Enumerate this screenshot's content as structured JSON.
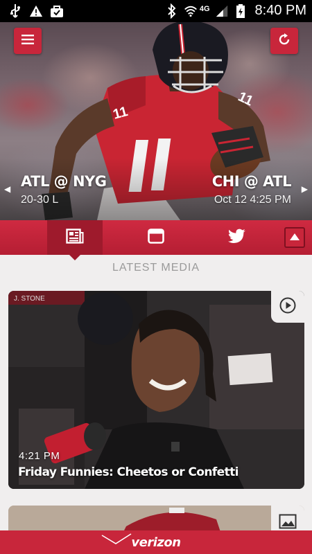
{
  "status_bar": {
    "time": "8:40 PM",
    "network": "4G",
    "left_icons": [
      "usb-icon",
      "warning-icon",
      "bag-icon"
    ],
    "right_icons": [
      "bluetooth-icon",
      "wifi-icon",
      "signal-icon",
      "battery-icon"
    ]
  },
  "hero": {
    "left_game": {
      "title": "ATL @ NYG",
      "subtitle": "20-30 L"
    },
    "right_game": {
      "title": "CHI @ ATL",
      "subtitle": "Oct 12 4:25 PM"
    },
    "icons": {
      "menu": "menu-icon",
      "refresh": "refresh-icon",
      "prev": "chevron-left-icon",
      "next": "chevron-right-icon"
    }
  },
  "tabs": [
    {
      "name": "news",
      "icon": "newspaper-icon",
      "active": true
    },
    {
      "name": "schedule",
      "icon": "calendar-icon",
      "active": false
    },
    {
      "name": "twitter",
      "icon": "twitter-icon",
      "active": false
    }
  ],
  "section": {
    "title": "LATEST MEDIA"
  },
  "media": [
    {
      "time": "4:21 PM",
      "title": "Friday Funnies: Cheetos or Confetti",
      "type_icon": "play-icon"
    },
    {
      "time": "",
      "title": "",
      "type_icon": "image-icon"
    }
  ],
  "footer": {
    "brand": "verizon"
  },
  "colors": {
    "accent": "#c8263b",
    "accent_dark": "#9e1a2c",
    "background": "#f0eeee"
  }
}
